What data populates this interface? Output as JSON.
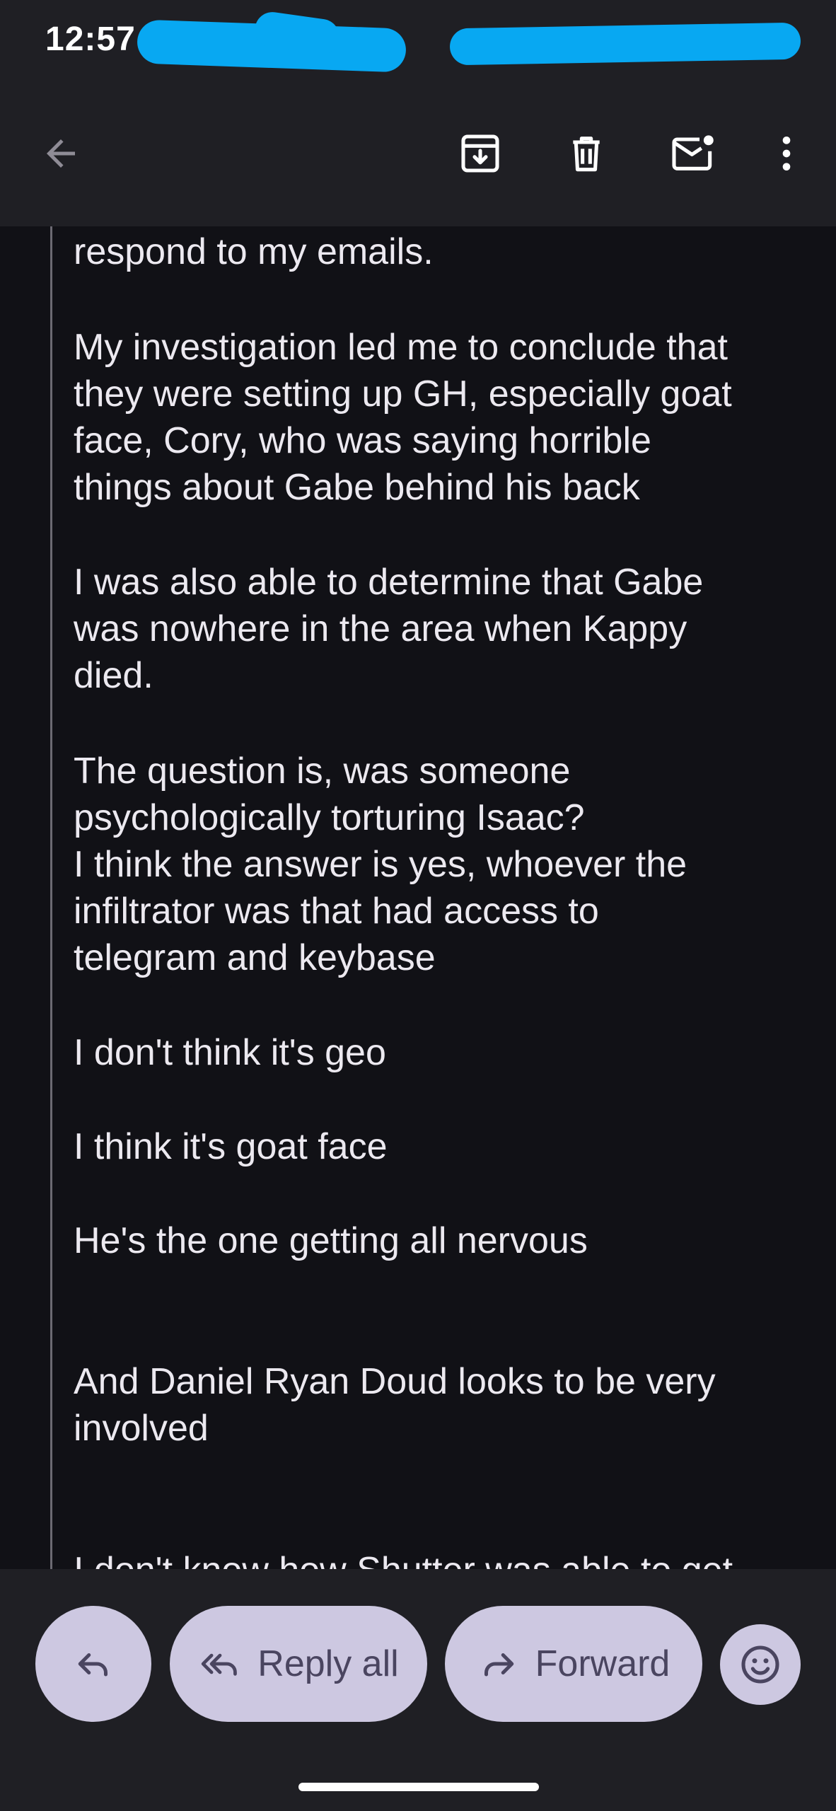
{
  "status_bar": {
    "time": "12:57"
  },
  "app_bar": {
    "icons": [
      "back-arrow-icon",
      "archive-icon",
      "delete-icon",
      "mark-unread-icon",
      "more-vert-icon"
    ]
  },
  "email": {
    "lines": [
      "respond to my emails.",
      "My investigation led me to conclude that\nthey were setting up GH, especially goat\nface, Cory, who was saying horrible\nthings about Gabe behind his back",
      "I was also able to determine that Gabe\nwas nowhere in the area when Kappy\ndied.",
      "The question is, was someone\npsychologically torturing Isaac?\nI think the answer is yes, whoever the\ninfiltrator was that had access to\ntelegram and keybase",
      "I don't think it's geo",
      "I think it's goat face",
      "He's the one getting all nervous",
      "And Daniel Ryan Doud looks to be very\ninvolved",
      "I don't know how Shutter was able to get"
    ]
  },
  "actions": {
    "reply_all": "Reply all",
    "forward": "Forward"
  },
  "colors": {
    "background": "#111116",
    "bar": "#1f1f24",
    "pill": "#cdc8e1",
    "pill_text": "#4a4560",
    "redaction": "#08a8f2"
  }
}
